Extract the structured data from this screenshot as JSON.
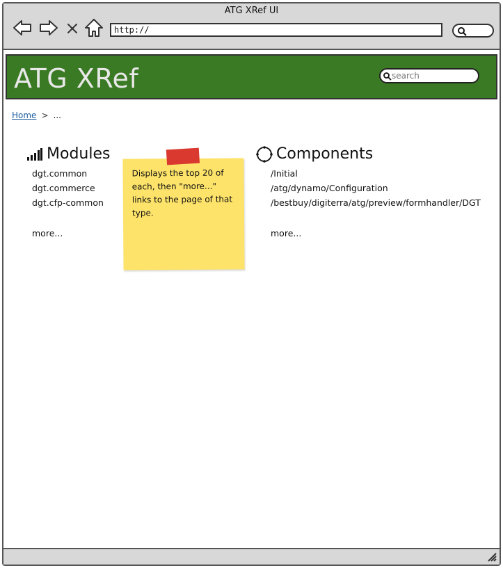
{
  "window": {
    "title": "ATG XRef UI",
    "address": "http://",
    "icons": [
      "back-arrow-icon",
      "forward-arrow-icon",
      "close-x-icon",
      "home-icon",
      "search-icon",
      "resize-grip-icon"
    ]
  },
  "header": {
    "brand": "ATG XRef",
    "search_placeholder": "search",
    "background": "#3b7a24"
  },
  "breadcrumb": {
    "home": "Home",
    "separator": ">",
    "current": "..."
  },
  "modules": {
    "title": "Modules",
    "icon": "signal-bars-icon",
    "items": [
      "dgt.common",
      "dgt.commerce",
      "dgt.cfp-common"
    ],
    "more": "more..."
  },
  "note": {
    "text": "Displays the top 20 of each, then \"more...\" links to the page of that type.",
    "color": "#fde36a",
    "tape_color": "#d9392f"
  },
  "components": {
    "title": "Components",
    "icon": "component-circle-icon",
    "items": [
      "/Initial",
      "/atg/dynamo/Configuration",
      "/bestbuy/digiterra/atg/preview/formhandler/DGT"
    ],
    "more": "more..."
  }
}
